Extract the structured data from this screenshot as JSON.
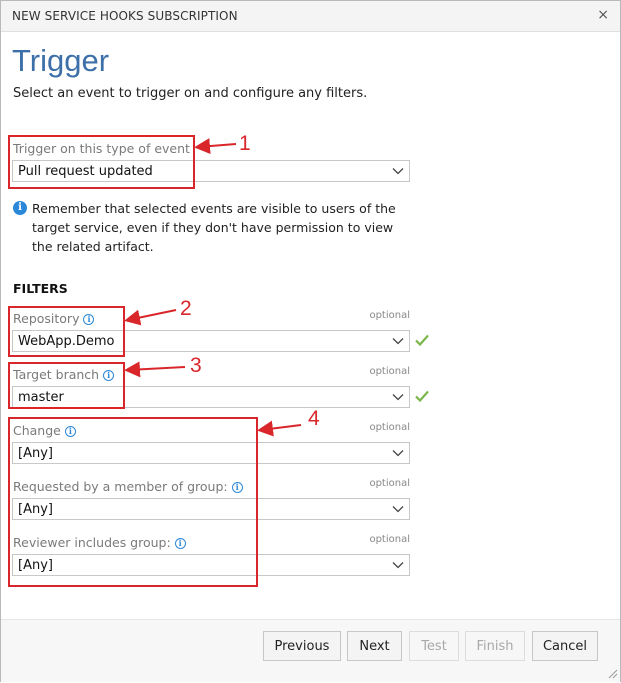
{
  "dialog": {
    "title": "NEW SERVICE HOOKS SUBSCRIPTION",
    "close_glyph": "×"
  },
  "page": {
    "heading": "Trigger",
    "subtitle": "Select an event to trigger on and configure any filters."
  },
  "trigger": {
    "label": "Trigger on this type of event",
    "value": "Pull request updated",
    "note": "Remember that selected events are visible to users of the target service, even if they don't have permission to view the related artifact."
  },
  "filters": {
    "heading": "FILTERS",
    "optional_label": "optional",
    "repository": {
      "label": "Repository",
      "value": "WebApp.Demo",
      "valid": true
    },
    "target_branch": {
      "label": "Target branch",
      "value": "master",
      "valid": true
    },
    "change": {
      "label": "Change",
      "value": "[Any]"
    },
    "requested_by": {
      "label": "Requested by a member of group:",
      "value": "[Any]"
    },
    "reviewer": {
      "label": "Reviewer includes group:",
      "value": "[Any]"
    }
  },
  "annotations": {
    "color": "#d9262b",
    "labels": [
      "1",
      "2",
      "3",
      "4"
    ]
  },
  "footer": {
    "previous": "Previous",
    "next": "Next",
    "test": "Test",
    "finish": "Finish",
    "cancel": "Cancel"
  },
  "icons": {
    "info": "info-circle-icon",
    "check": "checkmark-icon",
    "chevron": "chevron-down-icon",
    "close": "close-icon"
  },
  "colors": {
    "heading": "#3d6fa8",
    "info": "#2b88d8",
    "valid": "#7ab648"
  }
}
